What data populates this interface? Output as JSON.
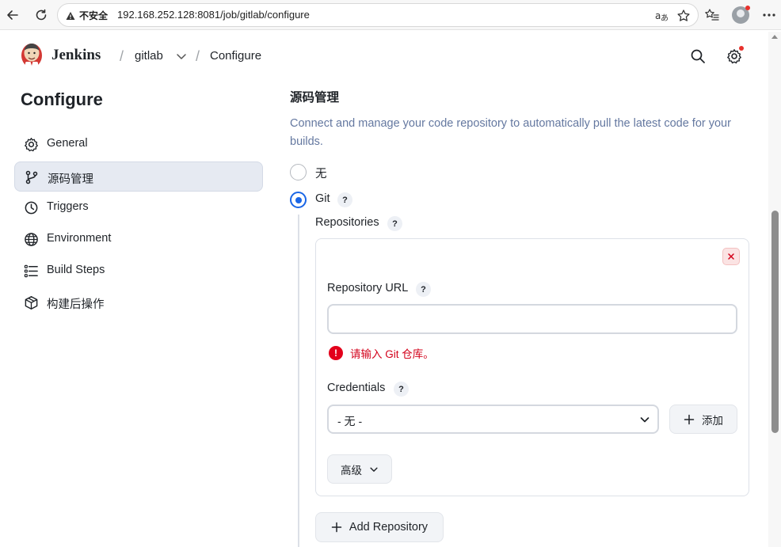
{
  "browser": {
    "insecure_label": "不安全",
    "url": "192.168.252.128:8081/job/gitlab/configure"
  },
  "header": {
    "brand": "Jenkins",
    "crumb_sep": "/",
    "crumb_job": "gitlab",
    "crumb_page": "Configure"
  },
  "sidebar": {
    "title": "Configure",
    "items": [
      {
        "label": "General",
        "icon": "gear-icon"
      },
      {
        "label": "源码管理",
        "icon": "source-branch-icon",
        "active": true
      },
      {
        "label": "Triggers",
        "icon": "timer-icon"
      },
      {
        "label": "Environment",
        "icon": "globe-icon"
      },
      {
        "label": "Build Steps",
        "icon": "list-icon"
      },
      {
        "label": "构建后操作",
        "icon": "package-icon"
      }
    ]
  },
  "main": {
    "section_title": "源码管理",
    "section_description": "Connect and manage your code repository to automatically pull the latest code for your builds.",
    "scm_options": [
      {
        "label": "无",
        "selected": false
      },
      {
        "label": "Git",
        "selected": true
      }
    ],
    "help_mark": "?",
    "repositories_label": "Repositories",
    "repository_url_label": "Repository URL",
    "repository_url_value": "",
    "error_message": "请输入 Git 仓库。",
    "credentials_label": "Credentials",
    "credentials_selected": "- 无 -",
    "add_button": "添加",
    "advanced_button": "高级",
    "add_repository_button": "Add Repository"
  },
  "colors": {
    "accent": "#1a66e6",
    "error": "#d3001a",
    "description": "#6478a0"
  }
}
